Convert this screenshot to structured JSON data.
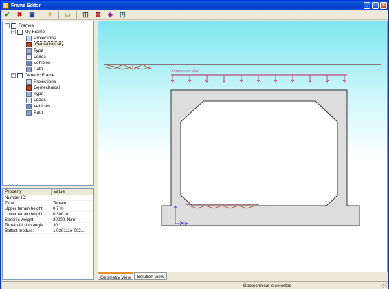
{
  "window": {
    "title": "Frame Editor",
    "minimize": "_",
    "maximize": "□",
    "close": "×"
  },
  "toolbar": {
    "accept_icon": "✔",
    "cancel_icon": "✖",
    "save_icon": "▣",
    "help_icon": "?",
    "note_icon": "▭",
    "copy_icon": "◫",
    "delete_icon": "⊠",
    "eraser_icon": "◈",
    "paste_icon": "◳",
    "colors": {
      "accept": "#1a8f1a",
      "cancel": "#c01010",
      "save": "#2a3d8f",
      "help": "#d4a000",
      "note": "#e6e24a"
    }
  },
  "tree": {
    "root": "Frames",
    "frames": [
      {
        "label": "My Frame",
        "children": [
          "Projections",
          "Geotechnical",
          "Type",
          "Loads",
          "Vehicles",
          "Path"
        ]
      },
      {
        "label": "Generic Frame",
        "children": [
          "Projections",
          "Geotechnical",
          "Type",
          "Loads",
          "Vehicles",
          "Path"
        ]
      }
    ],
    "selected": "Geotechnical"
  },
  "properties": {
    "headers": {
      "property": "Property",
      "value": "Value"
    },
    "rows": [
      {
        "key": "Number ID:",
        "value": "1"
      },
      {
        "key": "Type:",
        "value": "Terrain"
      },
      {
        "key": "Upper terrain height",
        "value": "0.7 m"
      },
      {
        "key": "Lower terrain height",
        "value": "0.300 m"
      },
      {
        "key": "Specific weight:",
        "value": "20000. N/m³"
      },
      {
        "key": "Terrain friction angle:",
        "value": "30 °"
      },
      {
        "key": "Ballast module:",
        "value": "1.039111e-002..."
      }
    ]
  },
  "canvas": {
    "load_label": "4.57547e+002 N/m²"
  },
  "tabs": {
    "geometry": "Geometry View",
    "solution": "Solution View"
  },
  "status": {
    "text": "Geotechnical is selected"
  }
}
